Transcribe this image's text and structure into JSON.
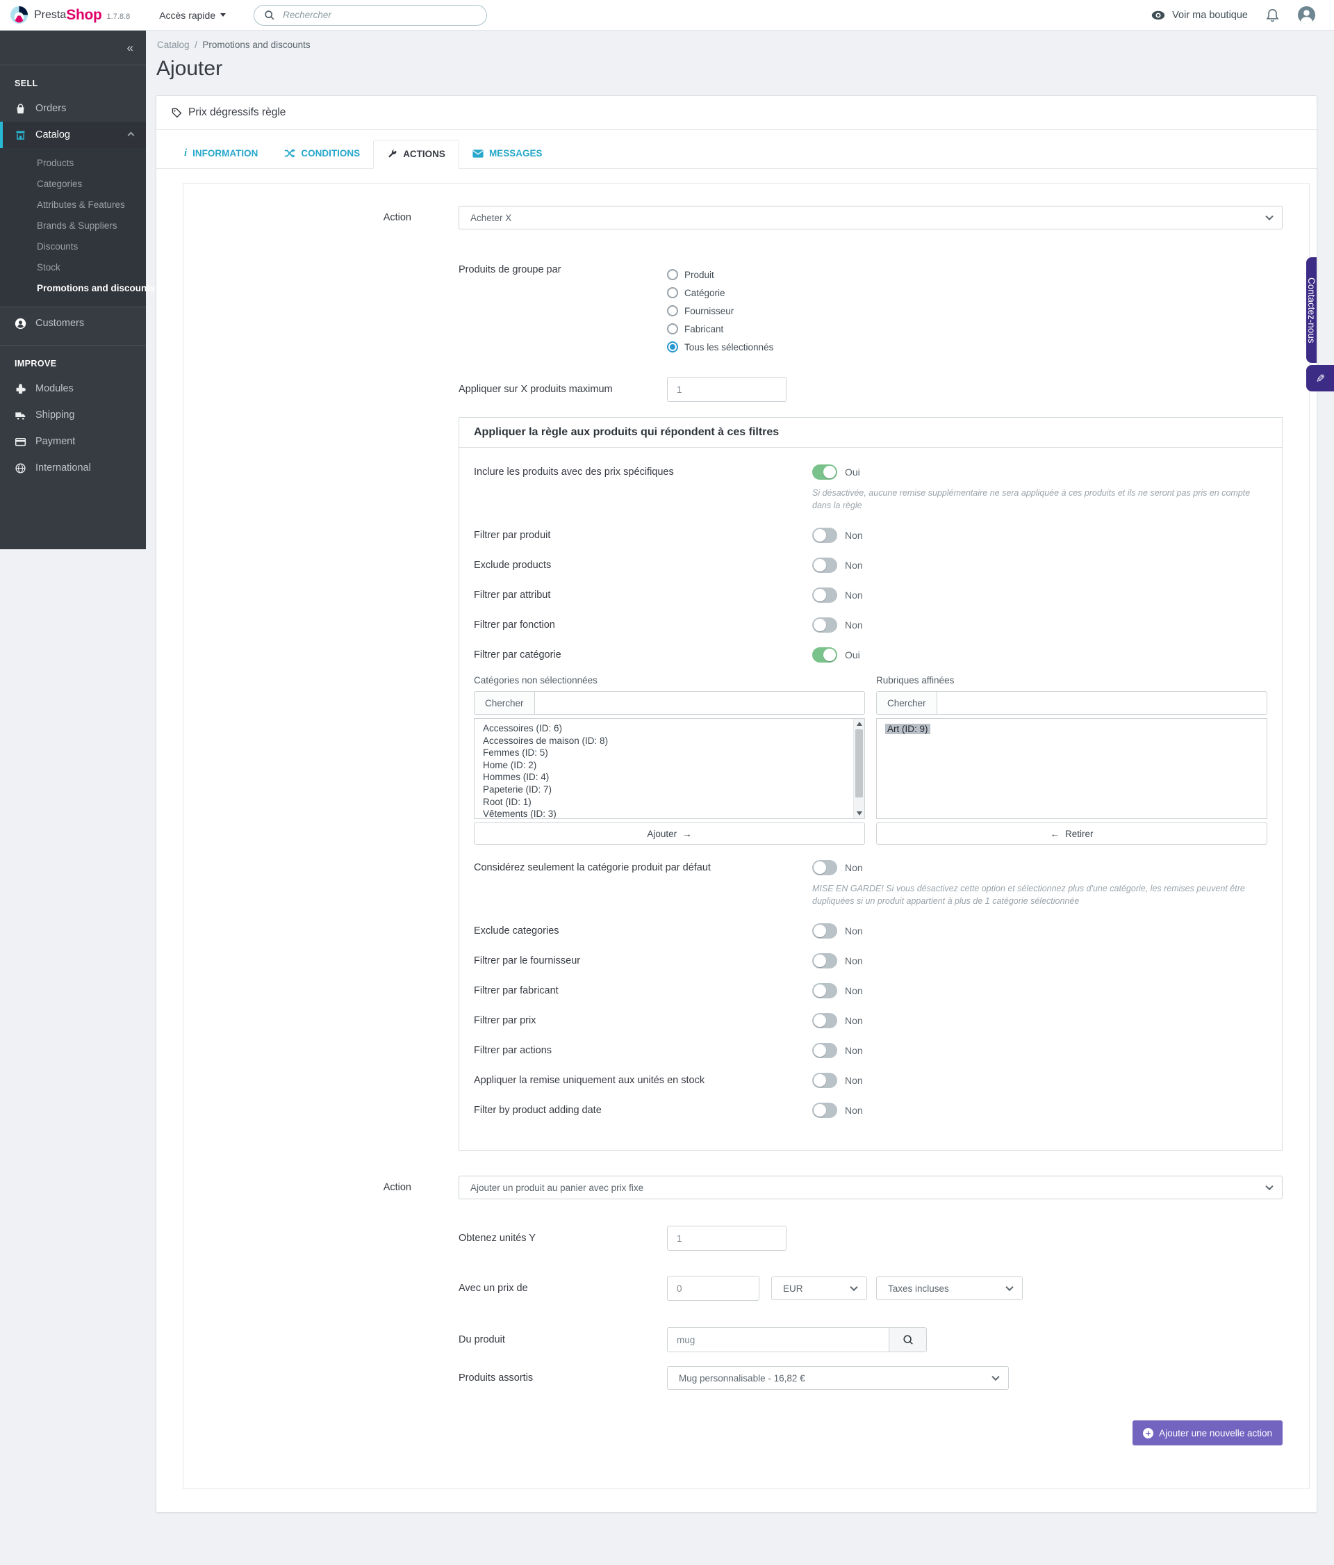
{
  "header": {
    "logo_text_1": "Presta",
    "logo_text_2": "Shop",
    "version": "1.7.8.8",
    "quick_access": "Accès rapide",
    "search_placeholder": "Rechercher",
    "view_shop": "Voir ma boutique"
  },
  "sidebar": {
    "collapse": "«",
    "sell_label": "SELL",
    "improve_label": "IMPROVE",
    "orders": "Orders",
    "catalog": "Catalog",
    "customers": "Customers",
    "catalog_sub": [
      "Products",
      "Categories",
      "Attributes & Features",
      "Brands & Suppliers",
      "Discounts",
      "Stock",
      "Promotions and discounts"
    ],
    "improve_items": [
      "Modules",
      "Shipping",
      "Payment",
      "International"
    ]
  },
  "breadcrumb": {
    "parent": "Catalog",
    "separator": "/",
    "current": "Promotions and discounts"
  },
  "page_title": "Ajouter",
  "panel": {
    "title": "Prix dégressifs règle"
  },
  "tabs": {
    "information": "INFORMATION",
    "conditions": "CONDITIONS",
    "actions": "ACTIONS",
    "messages": "MESSAGES"
  },
  "form": {
    "action1_label": "Action",
    "action1_value": "Acheter X",
    "group_by_label": "Produits de groupe par",
    "group_by_options": [
      "Produit",
      "Catégorie",
      "Fournisseur",
      "Fabricant",
      "Tous les sélectionnés"
    ],
    "group_by_selected": "Tous les sélectionnés",
    "max_label": "Appliquer sur X produits maximum",
    "max_value": "1",
    "filters": {
      "title": "Appliquer la règle aux produits qui répondent à ces filtres",
      "include_specific": {
        "label": "Inclure les produits avec des prix spécifiques",
        "state": "Oui",
        "helper": "Si désactivée, aucune remise supplémentaire ne sera appliquée à ces produits et ils ne seront pas pris en compte dans la règle"
      },
      "filter_product": {
        "label": "Filtrer par produit",
        "state": "Non"
      },
      "exclude_products": {
        "label": "Exclude products",
        "state": "Non"
      },
      "filter_attribute": {
        "label": "Filtrer par attribut",
        "state": "Non"
      },
      "filter_feature": {
        "label": "Filtrer par fonction",
        "state": "Non"
      },
      "filter_category": {
        "label": "Filtrer par catégorie",
        "state": "Oui"
      },
      "categories": {
        "left_title": "Catégories non sélectionnées",
        "right_title": "Rubriques affinées",
        "search_label": "Chercher",
        "available": [
          "Accessoires (ID: 6)",
          "Accessoires de maison (ID: 8)",
          "Femmes (ID: 5)",
          "Home (ID: 2)",
          "Hommes (ID: 4)",
          "Papeterie (ID: 7)",
          "Root (ID: 1)",
          "Vêtements (ID: 3)"
        ],
        "selected": "Art (ID: 9)",
        "add_label": "Ajouter",
        "add_arrow": "→",
        "remove_label": "Retirer",
        "remove_arrow": "←"
      },
      "default_category": {
        "label": "Considérez seulement la catégorie produit par défaut",
        "state": "Non",
        "helper": "MISE EN GARDE! Si vous désactivez cette option et sélectionnez plus d'une catégorie, les remises peuvent être dupliquées si un produit appartient à plus de 1 catégorie sélectionnée"
      },
      "exclude_categories": {
        "label": "Exclude categories",
        "state": "Non"
      },
      "filter_supplier": {
        "label": "Filtrer par le fournisseur",
        "state": "Non"
      },
      "filter_manufacturer": {
        "label": "Filtrer par fabricant",
        "state": "Non"
      },
      "filter_price": {
        "label": "Filtrer par prix",
        "state": "Non"
      },
      "filter_actions": {
        "label": "Filtrer par actions",
        "state": "Non"
      },
      "stock_only": {
        "label": "Appliquer la remise uniquement aux unités en stock",
        "state": "Non"
      },
      "adding_date": {
        "label": "Filter by product adding date",
        "state": "Non"
      }
    },
    "action2_label": "Action",
    "action2_value": "Ajouter un produit au panier avec prix fixe",
    "units_label": "Obtenez unités Y",
    "units_value": "1",
    "price_label": "Avec un prix de",
    "price_value": "0",
    "currency_value": "EUR",
    "tax_value": "Taxes incluses",
    "product_label": "Du produit",
    "product_value": "mug",
    "assorted_label": "Produits assortis",
    "assorted_value": "Mug personnalisable - 16,82 €",
    "add_action_button": "Ajouter une nouvelle action"
  },
  "contact_tab": "Contactez-nous",
  "contact_pencil": "✎",
  "colors": {
    "primary": "#28b8d4",
    "success_green": "#7ac28b",
    "purple_button": "#7364c0",
    "contact_purple": "#3d2c86",
    "brand_pink": "#df0067",
    "brand_navy": "#011638"
  }
}
